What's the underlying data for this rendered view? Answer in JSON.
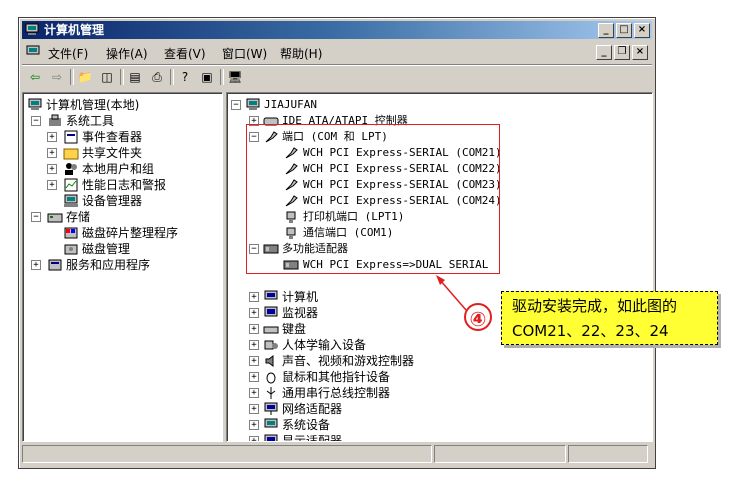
{
  "window": {
    "title": "计算机管理"
  },
  "menu": [
    "文件(F)",
    "操作(A)",
    "查看(V)",
    "窗口(W)",
    "帮助(H)"
  ],
  "left_tree": {
    "root": "计算机管理(本地)",
    "items": [
      "系统工具",
      "事件查看器",
      "共享文件夹",
      "本地用户和组",
      "性能日志和警报",
      "设备管理器",
      "存储",
      "磁盘碎片整理程序",
      "磁盘管理",
      "服务和应用程序"
    ]
  },
  "right_tree": {
    "root": "JIAJUFAN",
    "ide": "IDE ATA/ATAPI 控制器",
    "ports": "端口 (COM 和 LPT)",
    "port_items": [
      "WCH PCI Express-SERIAL (COM21)",
      "WCH PCI Express-SERIAL (COM22)",
      "WCH PCI Express-SERIAL (COM23)",
      "WCH PCI Express-SERIAL (COM24)",
      "打印机端口 (LPT1)",
      "通信端口 (COM1)"
    ],
    "multi": "多功能适配器",
    "multi_item": "WCH PCI Express=>DUAL SERIAL",
    "others": [
      "计算机",
      "监视器",
      "键盘",
      "人体学输入设备",
      "声音、视频和游戏控制器",
      "鼠标和其他指针设备",
      "通用串行总线控制器",
      "网络适配器",
      "系统设备",
      "显示适配器"
    ]
  },
  "callout": {
    "number": "④",
    "line1": "驱动安装完成，如此图的",
    "line2": "COM21、22、23、24"
  },
  "colors": {
    "titlebar": "#0a246a",
    "callout_bg": "#ffff33",
    "highlight": "#e02020"
  }
}
